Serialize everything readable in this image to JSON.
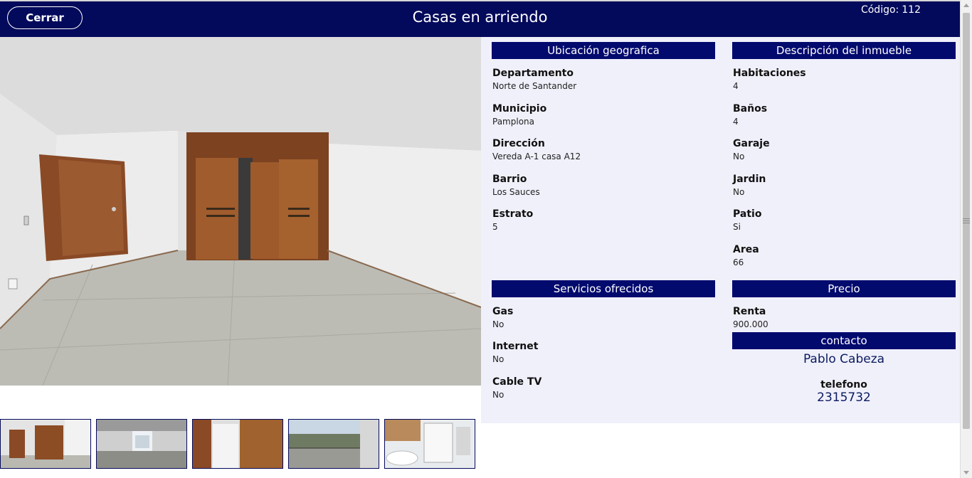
{
  "header": {
    "close_label": "Cerrar",
    "title": "Casas en arriendo",
    "code_label": "Código:",
    "code_value": "112"
  },
  "ubicacion": {
    "title": "Ubicación geografica",
    "fields": [
      {
        "label": "Departamento",
        "value": "Norte de Santander"
      },
      {
        "label": "Municipio",
        "value": "Pamplona"
      },
      {
        "label": "Dirección",
        "value": "Vereda A-1 casa A12"
      },
      {
        "label": "Barrio",
        "value": "Los Sauces"
      },
      {
        "label": "Estrato",
        "value": "5"
      }
    ]
  },
  "descripcion": {
    "title": "Descripción del inmueble",
    "fields": [
      {
        "label": "Habitaciones",
        "value": "4"
      },
      {
        "label": "Baños",
        "value": "4"
      },
      {
        "label": "Garaje",
        "value": "No"
      },
      {
        "label": "Jardin",
        "value": "No"
      },
      {
        "label": "Patio",
        "value": "Si"
      },
      {
        "label": "Area",
        "value": "66"
      }
    ]
  },
  "servicios": {
    "title": "Servicios ofrecidos",
    "fields": [
      {
        "label": "Gas",
        "value": "No"
      },
      {
        "label": "Internet",
        "value": "No"
      },
      {
        "label": "Cable TV",
        "value": "No"
      }
    ]
  },
  "precio": {
    "title": "Precio",
    "fields": [
      {
        "label": "Renta",
        "value": "900.000"
      }
    ]
  },
  "contacto": {
    "title": "contacto",
    "name": "Pablo Cabeza",
    "phone_label": "telefono",
    "phone": "2315732"
  },
  "colors": {
    "header_bg": "#030a5b",
    "section_bg": "#030a6e",
    "panel_bg": "#f0f0fb"
  }
}
